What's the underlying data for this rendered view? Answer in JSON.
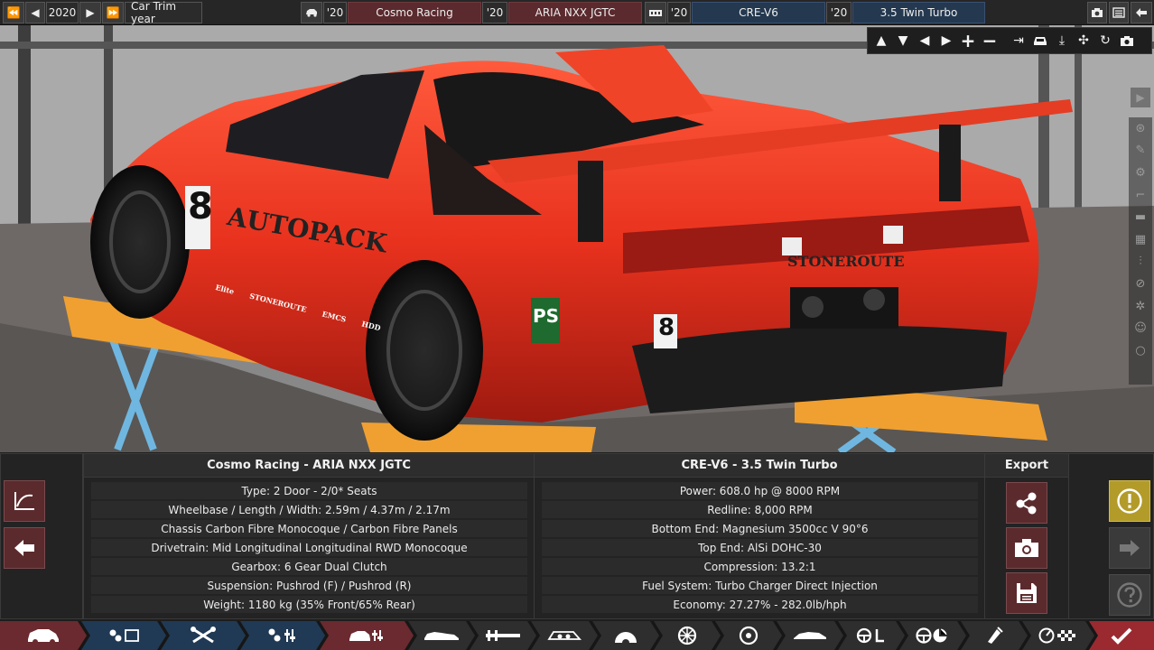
{
  "topbar": {
    "year_prev2": "⏪",
    "year_prev": "◀",
    "year": "2020",
    "year_next": "▶",
    "year_next2": "⏩",
    "trim_label": "Car Trim year",
    "car_year": "'20",
    "company": "Cosmo Racing",
    "model_year": "'20",
    "model": "ARIA NXX JGTC",
    "engine_year": "'20",
    "engine_family": "CRE-V6",
    "variant_year": "'20",
    "variant": "3.5 Twin Turbo"
  },
  "car": {
    "livery_main": "AUTOPACK",
    "livery_rear": "STONEROUTE",
    "number": "8",
    "badge": "PS",
    "sponsors": [
      "Elite",
      "STONEROUTE",
      "EMCS",
      "HDD"
    ]
  },
  "colors": {
    "car_body": "#e8321e",
    "lift": "#f0a030",
    "lift_legs": "#6fb7e0",
    "maroon": "#6a2a2f",
    "blue": "#203a55",
    "gold": "#b39b2a"
  },
  "car_panel": {
    "title": "Cosmo Racing - ARIA NXX JGTC",
    "rows": [
      "Type: 2 Door - 2/0* Seats",
      "Wheelbase / Length / Width: 2.59m / 4.37m / 2.17m",
      "Chassis Carbon Fibre Monocoque / Carbon Fibre Panels",
      "Drivetrain: Mid Longitudinal Longitudinal RWD Monocoque",
      "Gearbox: 6 Gear Dual Clutch",
      "Suspension: Pushrod (F) / Pushrod (R)",
      "Weight: 1180 kg (35% Front/65% Rear)"
    ]
  },
  "engine_panel": {
    "title": "CRE-V6 - 3.5 Twin Turbo",
    "rows": [
      "Power: 608.0 hp @ 8000 RPM",
      "Redline:  8,000 RPM",
      "Bottom End: Magnesium 3500cc V 90°6",
      "Top End: AlSi DOHC-30",
      "Compression: 13.2:1",
      "Fuel System: Turbo Charger Direct Injection",
      "Economy: 27.27% - 282.0lb/hph"
    ]
  },
  "export_panel": {
    "title": "Export"
  },
  "icons": {
    "graph": "⤤",
    "back": "🡄",
    "share": "⚬",
    "camera": "📷",
    "save": "💾",
    "warning": "!",
    "next": "🡆",
    "help": "?"
  }
}
